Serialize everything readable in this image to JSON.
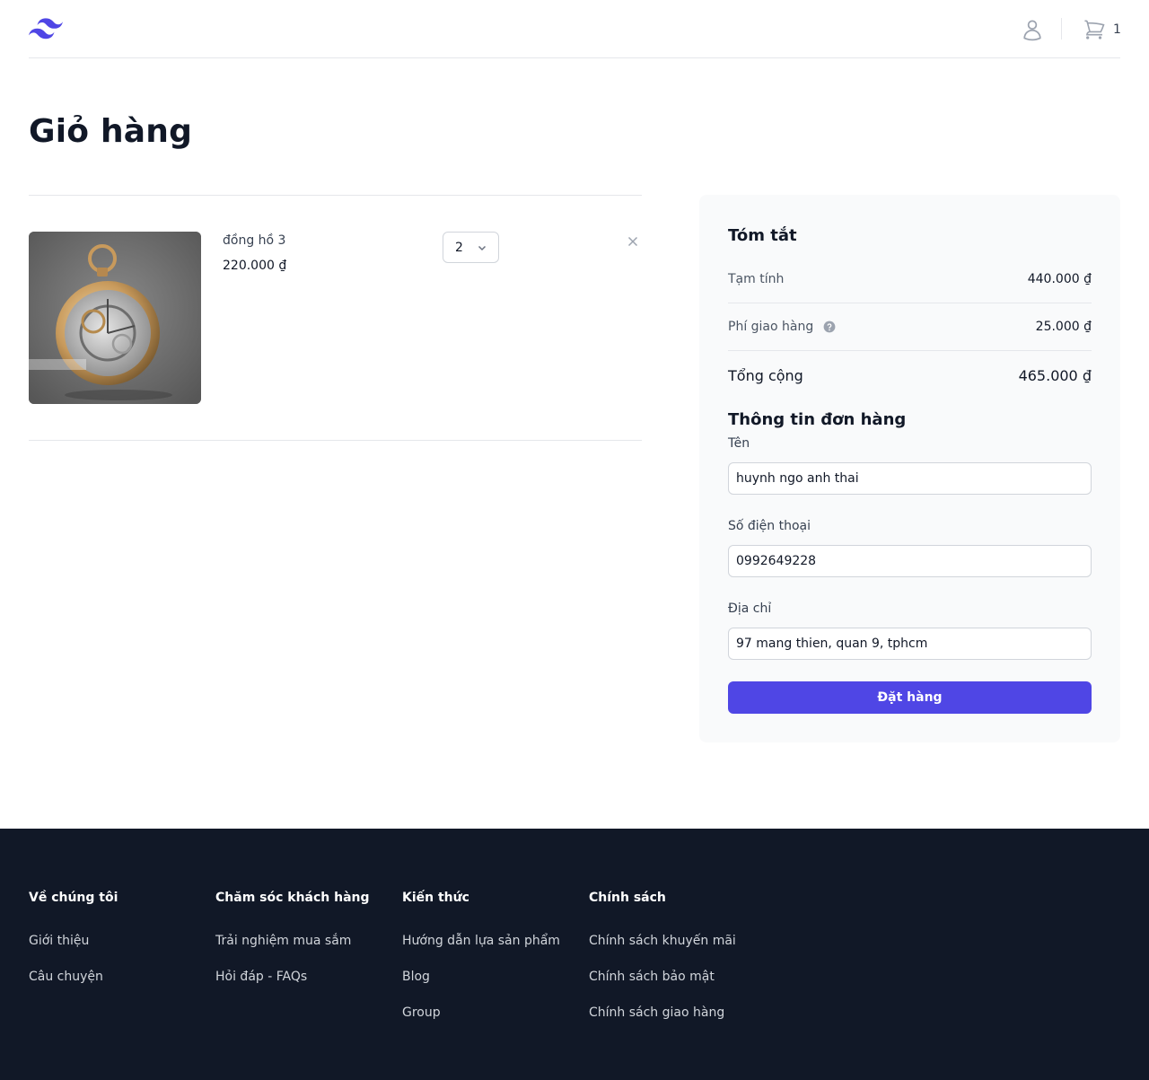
{
  "header": {
    "logo_icon": "tailwind-logo-icon",
    "account_icon": "user-icon",
    "cart_icon": "shopping-cart-icon",
    "cart_count": "1",
    "brand_color": "#4f46e5"
  },
  "page": {
    "title": "Giỏ hàng"
  },
  "cart": {
    "items": [
      {
        "name": "đồng hồ 3",
        "price": "220.000 ₫",
        "quantity": "2",
        "image": "pocket-watch-photo",
        "remove_icon": "close-icon"
      }
    ]
  },
  "summary": {
    "title": "Tóm tắt",
    "subtotal_label": "Tạm tính",
    "subtotal_value": "440.000 ₫",
    "shipping_label": "Phí giao hàng",
    "shipping_value": "25.000 ₫",
    "shipping_help_icon": "question-circle-icon",
    "total_label": "Tổng cộng",
    "total_value": "465.000 ₫"
  },
  "order_form": {
    "title": "Thông tin đơn hàng",
    "name_label": "Tên",
    "name_value": "huynh ngo anh thai",
    "phone_label": "Số điện thoại",
    "phone_value": "0992649228",
    "address_label": "Địa chỉ",
    "address_value": "97 mang thien, quan 9, tphcm",
    "submit_label": "Đặt hàng",
    "submit_color": "#4f46e5"
  },
  "footer": {
    "background": "#111827",
    "columns": [
      {
        "heading": "Về chúng tôi",
        "links": [
          "Giới thiệu",
          "Câu chuyện"
        ]
      },
      {
        "heading": "Chăm sóc khách hàng",
        "links": [
          "Trải nghiệm mua sắm",
          "Hỏi đáp - FAQs"
        ]
      },
      {
        "heading": "Kiến thức",
        "links": [
          "Hướng dẫn lựa sản phẩm",
          "Blog",
          "Group"
        ]
      },
      {
        "heading": "Chính sách",
        "links": [
          "Chính sách khuyến mãi",
          "Chính sách bảo mật",
          "Chính sách giao hàng"
        ]
      }
    ]
  }
}
